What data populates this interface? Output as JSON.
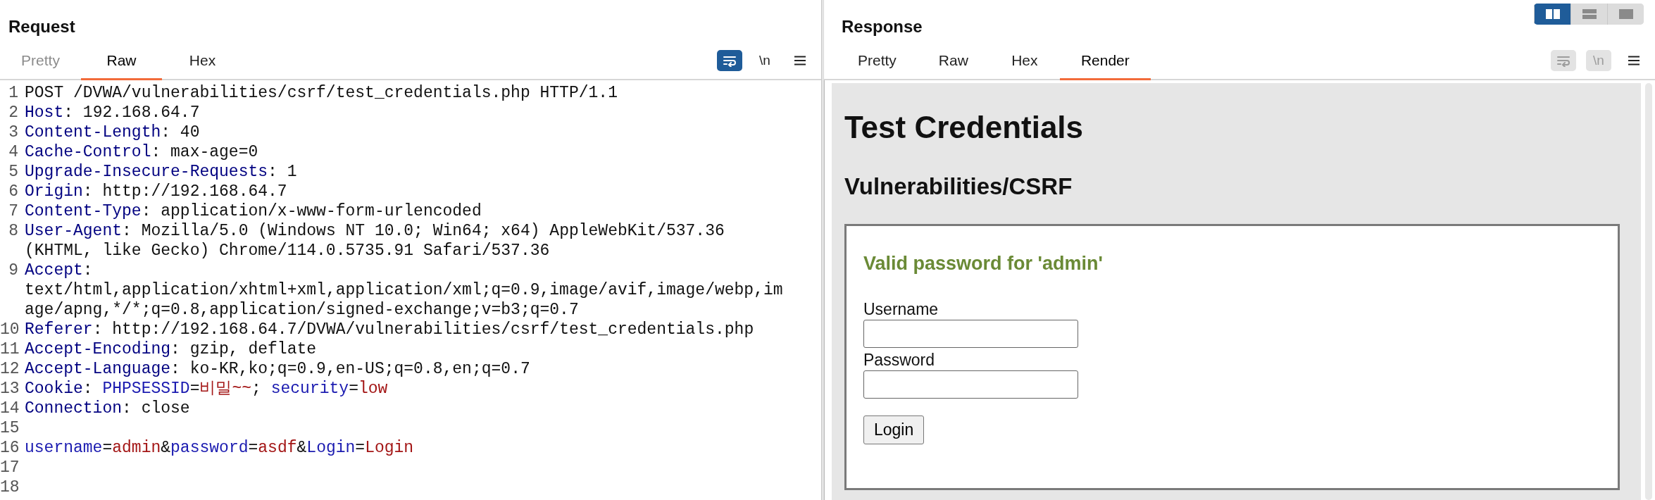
{
  "request": {
    "title": "Request",
    "tabs": [
      {
        "label": "Pretty",
        "selected": false,
        "disabled": true
      },
      {
        "label": "Raw",
        "selected": true,
        "disabled": false
      },
      {
        "label": "Hex",
        "selected": false,
        "disabled": false
      }
    ],
    "toolbar": [
      {
        "kind": "wrap",
        "on": true,
        "disabled": false
      },
      {
        "kind": "newline",
        "label": "\\n",
        "on": false,
        "disabled": false
      },
      {
        "kind": "menu",
        "on": false,
        "disabled": false
      }
    ],
    "lines": [
      {
        "number": "1",
        "parts": [
          {
            "kind": "plain",
            "text": "POST /DVWA/vulnerabilities/csrf/test_credentials.php HTTP/1.1"
          }
        ]
      },
      {
        "number": "2",
        "parts": [
          {
            "kind": "header",
            "text": "Host"
          },
          {
            "kind": "plain",
            "text": ": 192.168.64.7"
          }
        ]
      },
      {
        "number": "3",
        "parts": [
          {
            "kind": "header",
            "text": "Content-Length"
          },
          {
            "kind": "plain",
            "text": ": 40"
          }
        ]
      },
      {
        "number": "4",
        "parts": [
          {
            "kind": "header",
            "text": "Cache-Control"
          },
          {
            "kind": "plain",
            "text": ": max-age=0"
          }
        ]
      },
      {
        "number": "5",
        "parts": [
          {
            "kind": "header",
            "text": "Upgrade-Insecure-Requests"
          },
          {
            "kind": "plain",
            "text": ": 1"
          }
        ]
      },
      {
        "number": "6",
        "parts": [
          {
            "kind": "header",
            "text": "Origin"
          },
          {
            "kind": "plain",
            "text": ": http://192.168.64.7"
          }
        ]
      },
      {
        "number": "7",
        "parts": [
          {
            "kind": "header",
            "text": "Content-Type"
          },
          {
            "kind": "plain",
            "text": ": application/x-www-form-urlencoded"
          }
        ]
      },
      {
        "number": "8",
        "parts": [
          {
            "kind": "header",
            "text": "User-Agent"
          },
          {
            "kind": "plain",
            "text": ": Mozilla/5.0 (Windows NT 10.0; Win64; x64) AppleWebKit/537.36 (KHTML, like Gecko) Chrome/114.0.5735.91 Safari/537.36"
          }
        ]
      },
      {
        "number": "9",
        "parts": [
          {
            "kind": "header",
            "text": "Accept"
          },
          {
            "kind": "plain",
            "text": ": text/html,application/xhtml+xml,application/xml;q=0.9,image/avif,image/webp,image/apng,*/*;q=0.8,application/signed-exchange;v=b3;q=0.7"
          }
        ]
      },
      {
        "number": "10",
        "parts": [
          {
            "kind": "header",
            "text": "Referer"
          },
          {
            "kind": "plain",
            "text": ": http://192.168.64.7/DVWA/vulnerabilities/csrf/test_credentials.php"
          }
        ]
      },
      {
        "number": "11",
        "parts": [
          {
            "kind": "header",
            "text": "Accept-Encoding"
          },
          {
            "kind": "plain",
            "text": ": gzip, deflate"
          }
        ]
      },
      {
        "number": "12",
        "parts": [
          {
            "kind": "header",
            "text": "Accept-Language"
          },
          {
            "kind": "plain",
            "text": ": ko-KR,ko;q=0.9,en-US;q=0.8,en;q=0.7"
          }
        ]
      },
      {
        "number": "13",
        "parts": [
          {
            "kind": "header",
            "text": "Cookie"
          },
          {
            "kind": "plain",
            "text": ": "
          },
          {
            "kind": "param",
            "text": "PHPSESSID"
          },
          {
            "kind": "plain",
            "text": "="
          },
          {
            "kind": "value",
            "text": "비밀~~"
          },
          {
            "kind": "plain",
            "text": "; "
          },
          {
            "kind": "param",
            "text": "security"
          },
          {
            "kind": "plain",
            "text": "="
          },
          {
            "kind": "value",
            "text": "low"
          }
        ]
      },
      {
        "number": "14",
        "parts": [
          {
            "kind": "header",
            "text": "Connection"
          },
          {
            "kind": "plain",
            "text": ": close"
          }
        ]
      },
      {
        "number": "15"
      },
      {
        "number": "16",
        "parts": [
          {
            "kind": "param",
            "text": "username"
          },
          {
            "kind": "plain",
            "text": "="
          },
          {
            "kind": "value",
            "text": "admin"
          },
          {
            "kind": "plain",
            "text": "&"
          },
          {
            "kind": "param",
            "text": "password"
          },
          {
            "kind": "plain",
            "text": "="
          },
          {
            "kind": "value",
            "text": "asdf"
          },
          {
            "kind": "plain",
            "text": "&"
          },
          {
            "kind": "param",
            "text": "Login"
          },
          {
            "kind": "plain",
            "text": "="
          },
          {
            "kind": "value",
            "text": "Login"
          }
        ]
      },
      {
        "number": "17"
      },
      {
        "number": "18"
      }
    ]
  },
  "response": {
    "title": "Response",
    "view_toggle": [
      {
        "kind": "side-by-side",
        "selected": true
      },
      {
        "kind": "stacked",
        "selected": false
      },
      {
        "kind": "single",
        "selected": false
      }
    ],
    "tabs": [
      {
        "label": "Pretty",
        "selected": false,
        "disabled": false
      },
      {
        "label": "Raw",
        "selected": false,
        "disabled": false
      },
      {
        "label": "Hex",
        "selected": false,
        "disabled": false
      },
      {
        "label": "Render",
        "selected": true,
        "disabled": false
      }
    ],
    "toolbar": [
      {
        "kind": "wrap",
        "on": false,
        "disabled": true
      },
      {
        "kind": "newline",
        "label": "\\n",
        "on": false,
        "disabled": true
      },
      {
        "kind": "menu",
        "on": false,
        "disabled": false
      }
    ],
    "render": {
      "heading": "Test Credentials",
      "subheading": "Vulnerabilities/CSRF",
      "message": "Valid password for 'admin'",
      "fields": [
        {
          "label": "Username"
        },
        {
          "label": "Password"
        }
      ],
      "button": "Login"
    }
  }
}
